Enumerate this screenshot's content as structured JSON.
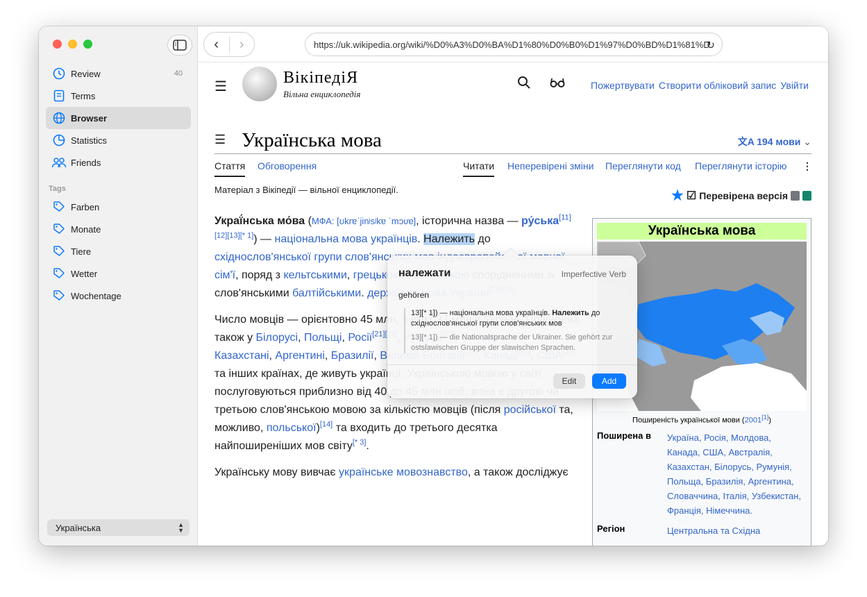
{
  "sidebar": {
    "items": [
      {
        "label": "Review",
        "count": "40"
      },
      {
        "label": "Terms"
      },
      {
        "label": "Browser"
      },
      {
        "label": "Statistics"
      },
      {
        "label": "Friends"
      }
    ],
    "tags_header": "Tags",
    "tags": [
      "Farben",
      "Monate",
      "Tiere",
      "Wetter",
      "Wochentage"
    ],
    "language": "Українська"
  },
  "browser": {
    "url": "https://uk.wikipedia.org/wiki/%D0%A3%D0%BA%D1%80%D0%B0%D1%97%D0%BD%D1%81%D"
  },
  "wiki": {
    "logo_title": "ВікіпедіЯ",
    "logo_subtitle": "Вільна енциклопедія",
    "donate": "Пожертвувати",
    "create_account": "Створити обліковий запис",
    "login": "Увійти",
    "page_title": "Українська мова",
    "languages": "194 мови",
    "tab_article": "Стаття",
    "tab_talk": "Обговорення",
    "tab_read": "Читати",
    "tab_unreviewed": "Неперевірені зміни",
    "tab_source": "Переглянути код",
    "tab_history": "Переглянути історію",
    "from": "Матеріал з Вікіпедії — вільної енциклопедії.",
    "verified": "Перевірена версія",
    "infobox": {
      "title": "Українська мова",
      "caption_a": "Поширеність української мови (",
      "caption_link": "2001",
      "caption_sup": "[1]",
      "caption_b": ")",
      "spread_label": "Поширена в",
      "spread_value": "Україна, Росія, Молдова, Канада, США, Австралія, Казахстан, Білорусь, Румунія, Польща, Бразилія, Аргентина, Словаччина, Італія, Узбекистан, Франція, Німеччина.",
      "region_label": "Регіон",
      "region_value": "Центральна та Східна"
    }
  },
  "popover": {
    "word": "належати",
    "pos": "Imperfective Verb",
    "translation": "gehören",
    "context_before": "13][* 1]) — національна мова українців. ",
    "context_bold": "Належить",
    "context_after": " до східнослов'янської групи слов'янських мов",
    "context_translation": "13][* 1]) — die Nationalsprache der Ukrainer. Sie gehört zur ostslawischen Gruppe der slawischen Sprachen.",
    "edit": "Edit",
    "add": "Add"
  },
  "colors": {
    "accent": "#0a7aff",
    "link": "#3366cc",
    "infobox_title": "#ccff99",
    "map_blue": "#1a73e8"
  },
  "icons": [
    "clock-icon",
    "book-icon",
    "globe-icon",
    "chart-icon",
    "people-icon",
    "tag-icon",
    "sidebar-toggle-icon",
    "search-icon",
    "glasses-icon",
    "translate-icon",
    "star-icon"
  ]
}
